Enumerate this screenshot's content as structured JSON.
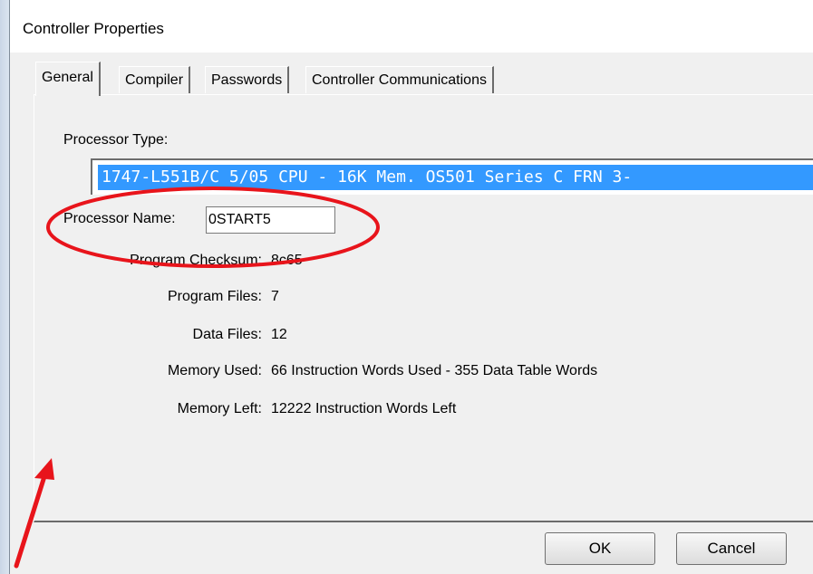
{
  "window": {
    "title": "Controller Properties"
  },
  "tabs": [
    {
      "label": "General",
      "active": true
    },
    {
      "label": "Compiler",
      "active": false
    },
    {
      "label": "Passwords",
      "active": false
    },
    {
      "label": "Controller Communications",
      "active": false
    }
  ],
  "general": {
    "processor_type_label": "Processor Type:",
    "processor_type_value": "1747-L551B/C 5/05 CPU - 16K Mem. OS501 Series C FRN 3-",
    "processor_name_label": "Processor Name:",
    "processor_name_value": "0START5",
    "checksum_label": "Program Checksum:",
    "checksum_value": "8c65",
    "program_files_label": "Program Files:",
    "program_files_value": "7",
    "data_files_label": "Data Files:",
    "data_files_value": "12",
    "memory_used_label": "Memory Used:",
    "memory_used_value": "66 Instruction Words Used - 355 Data Table Words",
    "memory_left_label": "Memory Left:",
    "memory_left_value": "12222 Instruction Words Left"
  },
  "buttons": {
    "ok": "OK",
    "cancel": "Cancel"
  },
  "annotation": {
    "color": "#e8141b"
  }
}
